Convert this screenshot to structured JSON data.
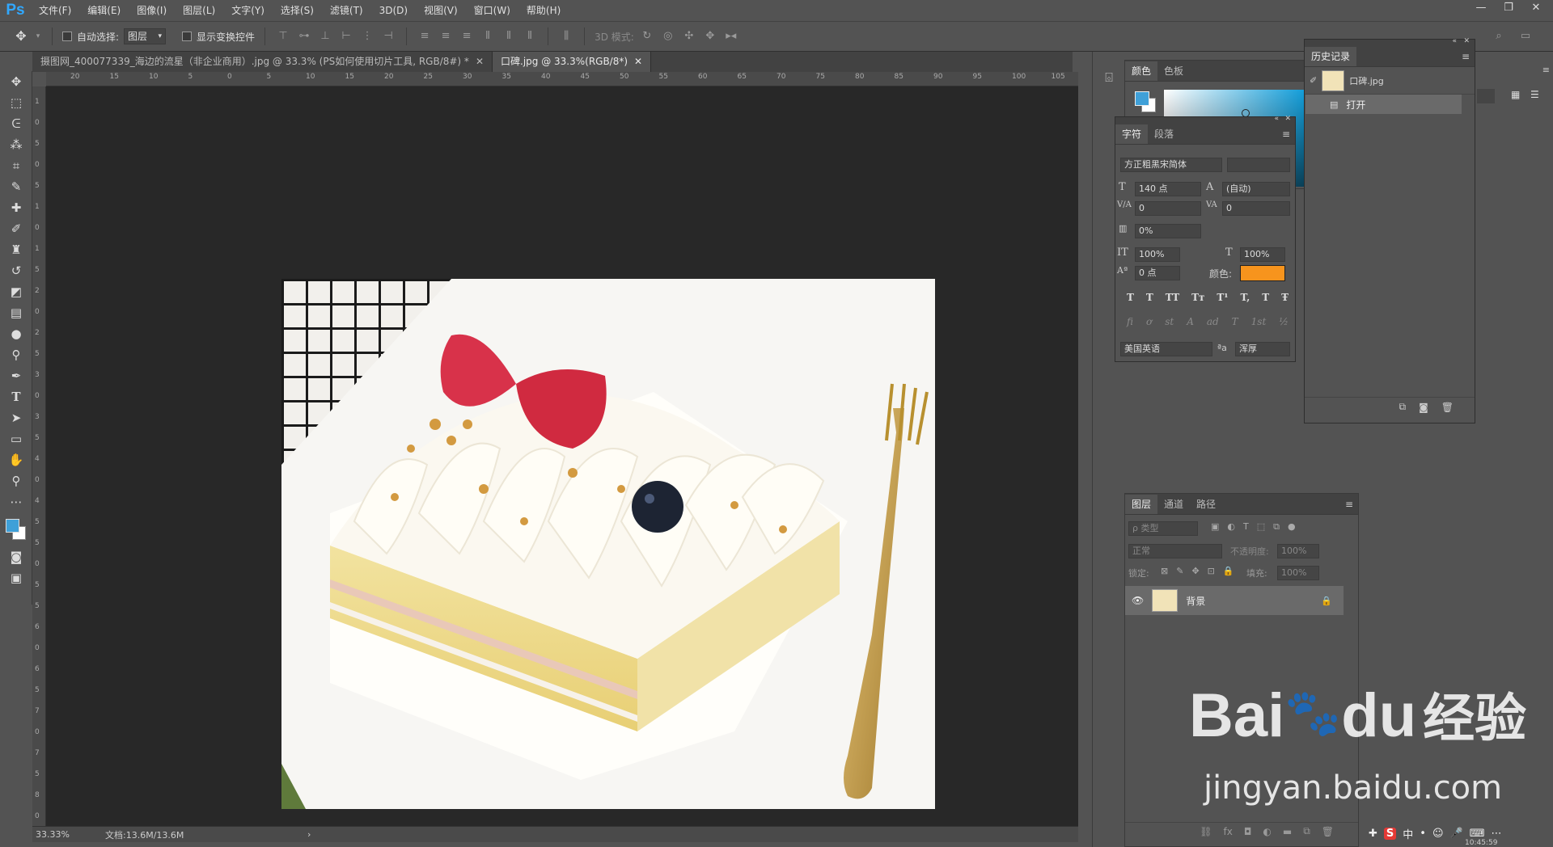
{
  "app": {
    "logo": "Ps"
  },
  "menu": [
    "文件(F)",
    "编辑(E)",
    "图像(I)",
    "图层(L)",
    "文字(Y)",
    "选择(S)",
    "滤镜(T)",
    "3D(D)",
    "视图(V)",
    "窗口(W)",
    "帮助(H)"
  ],
  "window_controls": {
    "minimize": "—",
    "restore": "❐",
    "close": "✕"
  },
  "options": {
    "auto_select_label": "自动选择:",
    "auto_select_value": "图层",
    "show_transform_label": "显示变换控件",
    "mode3d_label": "3D 模式:"
  },
  "tabs": [
    {
      "label": "摄图网_400077339_海边的流星（非企业商用）.jpg @ 33.3% (PS如何使用切片工具, RGB/8#) *",
      "close": "✕"
    },
    {
      "label": "口碑.jpg @ 33.3%(RGB/8*)",
      "close": "✕"
    }
  ],
  "ruler_top": [
    "20",
    "15",
    "10",
    "5",
    "0",
    "5",
    "10",
    "15",
    "20",
    "25",
    "30",
    "35",
    "40",
    "45",
    "50",
    "55",
    "60",
    "65",
    "70",
    "75",
    "80",
    "85",
    "90",
    "95",
    "100",
    "105"
  ],
  "ruler_left": [
    "1",
    "0",
    "5",
    "0",
    "5",
    "1",
    "0",
    "1",
    "5",
    "2",
    "0",
    "2",
    "5",
    "3",
    "0",
    "3",
    "5",
    "4",
    "0",
    "4",
    "5",
    "5",
    "0",
    "5",
    "5",
    "6",
    "0",
    "6",
    "5",
    "7",
    "0",
    "7",
    "5",
    "8",
    "0"
  ],
  "status": {
    "zoom": "33.33%",
    "doc": "文档:13.6M/13.6M",
    "arrow": "›"
  },
  "color_panel": {
    "tabs": [
      "颜色",
      "色板"
    ],
    "foreground": "#3fa0d8",
    "background": "#ffffff"
  },
  "character": {
    "tabs": [
      "字符",
      "段落"
    ],
    "font_family": "方正粗黑宋简体",
    "font_style": "",
    "size": "140 点",
    "leading": "(自动)",
    "kerning": "0",
    "tracking": "0",
    "tsume": "0%",
    "vscale": "100%",
    "hscale": "100%",
    "baseline": "0 点",
    "color_label": "颜色:",
    "color": "#f7941d",
    "style_buttons": [
      "T",
      "T",
      "TT",
      "Tт",
      "T¹",
      "T,",
      "T",
      "Ŧ"
    ],
    "opentype_buttons": [
      "ﬁ",
      "ơ",
      "st",
      "A",
      "ad",
      "T",
      "1st",
      "½"
    ],
    "language": "美国英语",
    "aa_icon": "ªa",
    "antialias": "浑厚"
  },
  "history": {
    "title": "历史记录",
    "snapshot": "口碑.jpg",
    "items": [
      "打开"
    ]
  },
  "layers": {
    "tabs": [
      "图层",
      "通道",
      "路径"
    ],
    "filter_label": "ρ 类型",
    "blend": "正常",
    "opacity_label": "不透明度:",
    "opacity": "100%",
    "lock_label": "锁定:",
    "fill_label": "填充:",
    "fill": "100%",
    "layer_name": "背景"
  },
  "watermark": {
    "brand": "Bai",
    "brand2": "du",
    "cn": "经验",
    "url": "jingyan.baidu.com"
  },
  "tray": {
    "lang": "中",
    "time": "10:45:59"
  }
}
